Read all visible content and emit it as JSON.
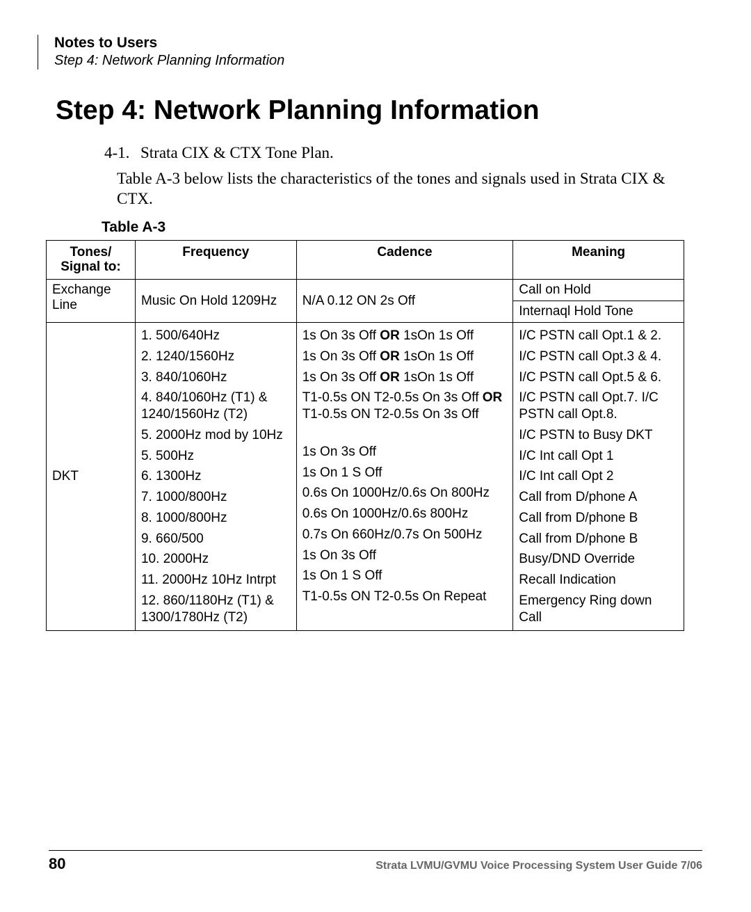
{
  "header": {
    "title_bold": "Notes to Users",
    "title_italic": "Step 4:  Network Planning Information"
  },
  "h1": "Step 4:  Network Planning Information",
  "listitem": {
    "num": "4-1.",
    "text": "Strata CIX & CTX Tone Plan."
  },
  "para": "Table A-3 below lists the characteristics of the tones and signals used in Strata CIX & CTX.",
  "table_caption": "Table A-3",
  "table_headers": {
    "c1a": "Tones/",
    "c1b": "Signal to:",
    "c2": "Frequency",
    "c3": "Cadence",
    "c4": "Meaning"
  },
  "row1": {
    "signal": "Exchange Line",
    "freq": "Music On Hold 1209Hz",
    "cadence": "N/A 0.12 ON 2s Off",
    "meaning1": "Call on Hold",
    "meaning2": "Internaql Hold Tone"
  },
  "row2": {
    "signal": "DKT",
    "freq": {
      "f1": "1. 500/640Hz",
      "f2": "2. 1240/1560Hz",
      "f3": "3. 840/1060Hz",
      "f4": "4. 840/1060Hz (T1) & 1240/1560Hz (T2)",
      "f5": "5. 2000Hz mod by 10Hz",
      "f6": "5. 500Hz",
      "f7": "6. 1300Hz",
      "f8": "7. 1000/800Hz",
      "f9": "8. 1000/800Hz",
      "f10": "9. 660/500",
      "f11": "10. 2000Hz",
      "f12": "11. 2000Hz 10Hz Intrpt",
      "f13": "12. 860/1180Hz (T1) & 1300/1780Hz (T2)"
    },
    "cad": {
      "c1a": "1s On 3s Off ",
      "c1b": "OR",
      "c1c": " 1sOn 1s Off",
      "c2a": "1s On 3s Off ",
      "c2b": "OR",
      "c2c": " 1sOn 1s Off",
      "c3a": "1s On 3s Off ",
      "c3b": "OR",
      "c3c": " 1sOn 1s Off",
      "c4a": "T1-0.5s ON T2-0.5s On 3s Off ",
      "c4b": "OR",
      "c4c": " T1-0.5s ON T2-0.5s On 3s Off",
      "c6": "1s On 3s Off",
      "c7": "1s On 1 S Off",
      "c8": "0.6s On 1000Hz/0.6s On 800Hz",
      "c9": "0.6s On 1000Hz/0.6s 800Hz",
      "c10": "0.7s On 660Hz/0.7s On 500Hz",
      "c11": "1s On 3s Off",
      "c12": "1s On 1 S Off",
      "c13": "T1-0.5s ON T2-0.5s On Repeat"
    },
    "mean": {
      "m1": "I/C PSTN call Opt.1 & 2.",
      "m2": "I/C PSTN call Opt.3 & 4.",
      "m3": "I/C PSTN call Opt.5 & 6.",
      "m4": "I/C PSTN call Opt.7. I/C PSTN call Opt.8.",
      "m5": "I/C PSTN to Busy DKT",
      "m6": "I/C Int call Opt 1",
      "m7": "I/C Int call Opt 2",
      "m8": "Call from D/phone A",
      "m9": "Call from D/phone B",
      "m10": "Call from D/phone B",
      "m11": "Busy/DND Override",
      "m12": "Recall Indication",
      "m13": "Emergency Ring down Call"
    }
  },
  "footer": {
    "page": "80",
    "right": "Strata LVMU/GVMU Voice Processing System User Guide    7/06"
  }
}
